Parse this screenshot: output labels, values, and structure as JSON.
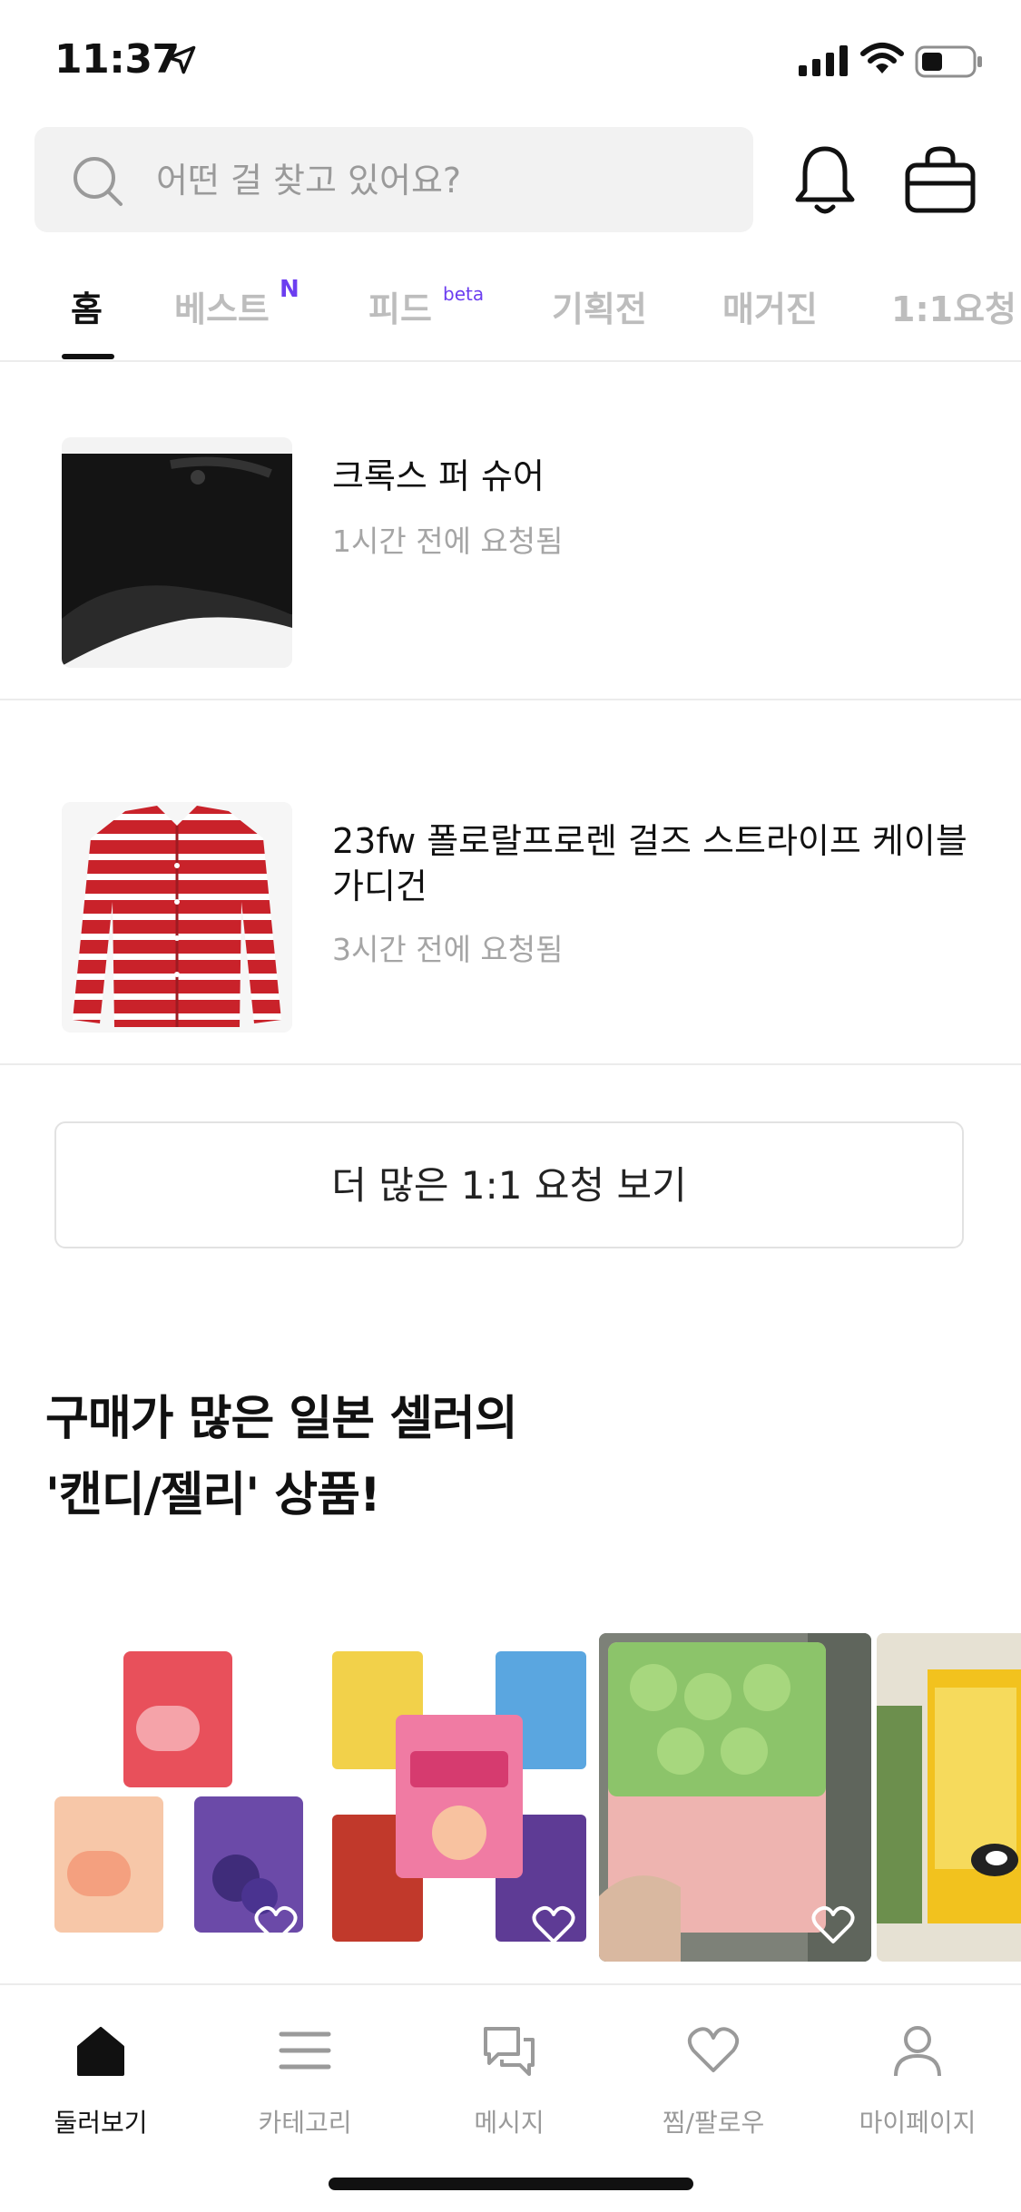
{
  "status_bar": {
    "time": "11:37"
  },
  "search": {
    "placeholder": "어떤 걸 찾고 있어요?"
  },
  "tabs": [
    {
      "label": "홈",
      "active": true
    },
    {
      "label": "베스트",
      "badge": "N"
    },
    {
      "label": "피드",
      "badge": "beta"
    },
    {
      "label": "기획전"
    },
    {
      "label": "매거진"
    },
    {
      "label": "1:1요청"
    }
  ],
  "requests": [
    {
      "title": "크록스 퍼 슈어",
      "time": "1시간 전에 요청됨"
    },
    {
      "title": "23fw 폴로랄프로렌 걸즈 스트라이프 케이블 가디건",
      "time": "3시간 전에 요청됨"
    }
  ],
  "more_button": {
    "label": "더 많은 1:1 요청 보기"
  },
  "section": {
    "title_line1": "구매가 많은 일본 셀러의",
    "title_line2": "'캔디/젤리' 상품!"
  },
  "bottom_nav": [
    {
      "label": "둘러보기",
      "active": true
    },
    {
      "label": "카테고리"
    },
    {
      "label": "메시지"
    },
    {
      "label": "찜/팔로우"
    },
    {
      "label": "마이페이지"
    }
  ],
  "colors": {
    "accent": "#6c3ef0",
    "inactive": "#bdbdbd",
    "subtext": "#a5a5a5"
  }
}
